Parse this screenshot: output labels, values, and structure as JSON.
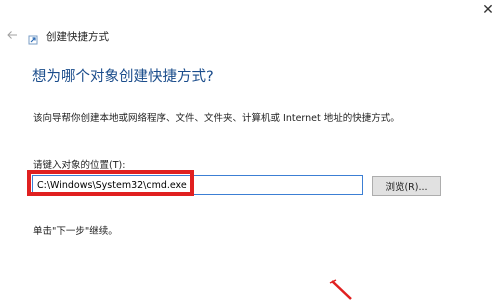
{
  "window": {
    "close_glyph": "✕"
  },
  "wizard": {
    "title": "创建快捷方式",
    "heading": "想为哪个对象创建快捷方式?",
    "description": "该向导帮你创建本地或网络程序、文件、文件夹、计算机或 Internet 地址的快捷方式。",
    "field_label": "请键入对象的位置(T):",
    "field_value": "C:\\Windows\\System32\\cmd.exe",
    "browse_label": "浏览(R)...",
    "hint": "单击\"下一步\"继续。"
  },
  "colors": {
    "heading": "#1a4c8b",
    "input_border": "#3c7fd4",
    "highlight": "#e02020",
    "button_bg": "#e1e1e1"
  },
  "icons": {
    "back": "back-arrow-icon",
    "close": "close-icon",
    "wizard": "shortcut-wizard-icon"
  }
}
